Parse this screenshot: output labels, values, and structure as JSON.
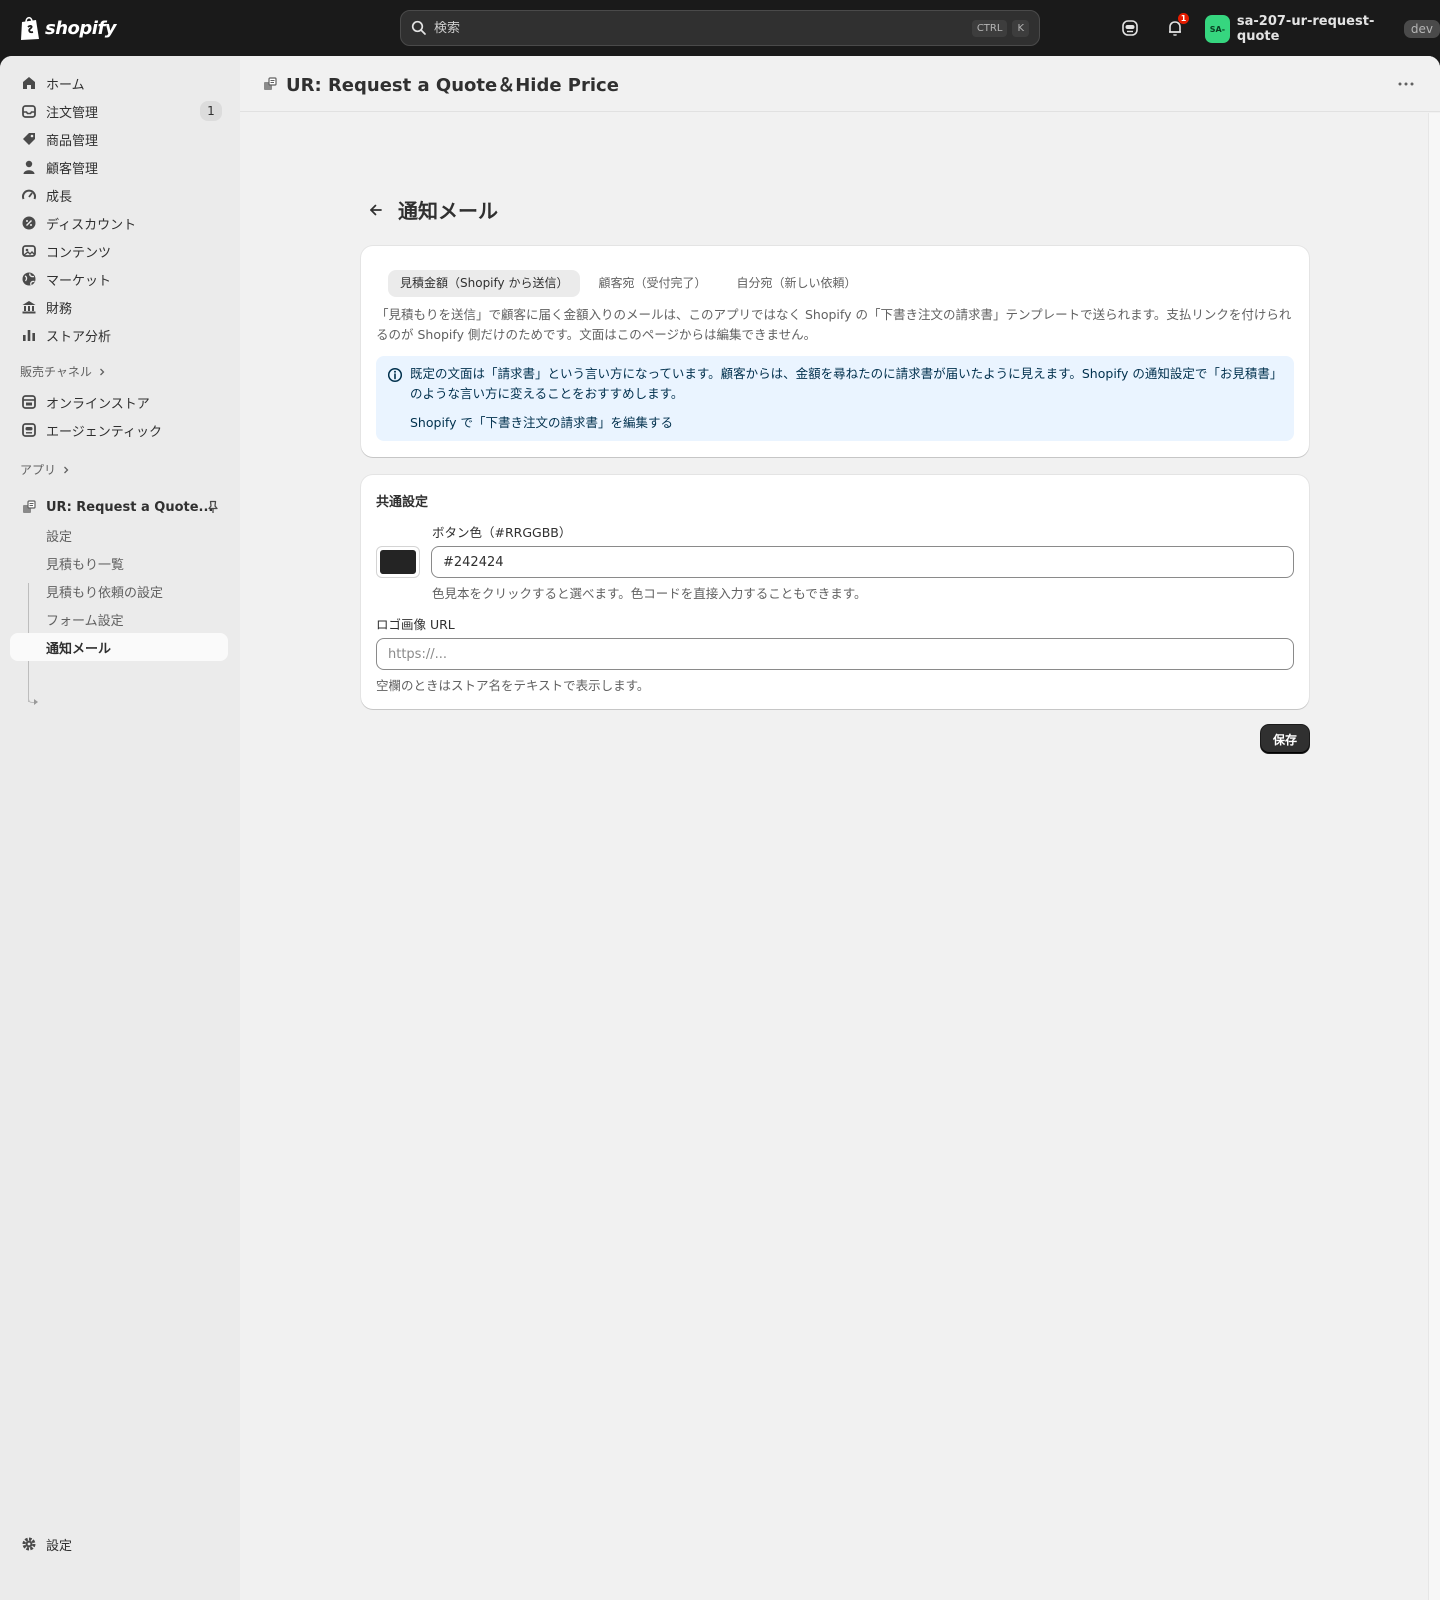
{
  "topbar": {
    "logo_text": "shopify",
    "search_placeholder": "検索",
    "shortcut_1": "CTRL",
    "shortcut_2": "K",
    "notification_count": "1",
    "avatar_initials": "SA-",
    "store_name": "sa-207-ur-request-quote",
    "env_badge": "dev"
  },
  "sidebar": {
    "items": [
      {
        "label": "ホーム",
        "icon": "home-icon"
      },
      {
        "label": "注文管理",
        "icon": "orders-icon",
        "count": "1"
      },
      {
        "label": "商品管理",
        "icon": "tag-icon"
      },
      {
        "label": "顧客管理",
        "icon": "person-icon"
      },
      {
        "label": "成長",
        "icon": "gauge-icon"
      },
      {
        "label": "ディスカウント",
        "icon": "discount-icon"
      },
      {
        "label": "コンテンツ",
        "icon": "content-icon"
      },
      {
        "label": "マーケット",
        "icon": "globe-icon"
      },
      {
        "label": "財務",
        "icon": "bank-icon"
      },
      {
        "label": "ストア分析",
        "icon": "chart-icon"
      }
    ],
    "channels_heading": "販売チャネル",
    "channels": [
      {
        "label": "オンラインストア",
        "icon": "store-icon"
      },
      {
        "label": "エージェンティック",
        "icon": "agentic-icon"
      }
    ],
    "apps_heading": "アプリ",
    "app_name": "UR: Request a Quote...",
    "app_subitems": [
      "設定",
      "見積もり一覧",
      "見積もり依頼の設定",
      "フォーム設定",
      "通知メール"
    ],
    "settings_label": "設定"
  },
  "app_header": {
    "title": "UR: Request a Quote＆Hide Price"
  },
  "page": {
    "title": "通知メール",
    "tabs": [
      "見積金額（Shopify から送信）",
      "顧客宛（受付完了）",
      "自分宛（新しい依頼）"
    ],
    "description": "「見積もりを送信」で顧客に届く金額入りのメールは、このアプリではなく Shopify の「下書き注文の請求書」テンプレートで送られます。支払リンクを付けられるのが Shopify 側だけのためです。文面はこのページからは編集できません。",
    "banner_text": "既定の文面は「請求書」という言い方になっています。顧客からは、金額を尋ねたのに請求書が届いたように見えます。Shopify の通知設定で「お見積書」のような言い方に変えることをおすすめします。",
    "banner_link": "Shopify で「下書き注文の請求書」を編集する",
    "common_title": "共通設定",
    "button_color_label": "ボタン色（#RRGGBB）",
    "button_color_value": "#242424",
    "button_color_help": "色見本をクリックすると選べます。色コードを直接入力することもできます。",
    "logo_label": "ロゴ画像 URL",
    "logo_placeholder": "https://...",
    "logo_help": "空欄のときはストア名をテキストで表示します。",
    "save_label": "保存"
  },
  "colors": {
    "swatch": "#242424",
    "accent_dark": "#303030",
    "banner_bg": "#eaf4ff"
  }
}
